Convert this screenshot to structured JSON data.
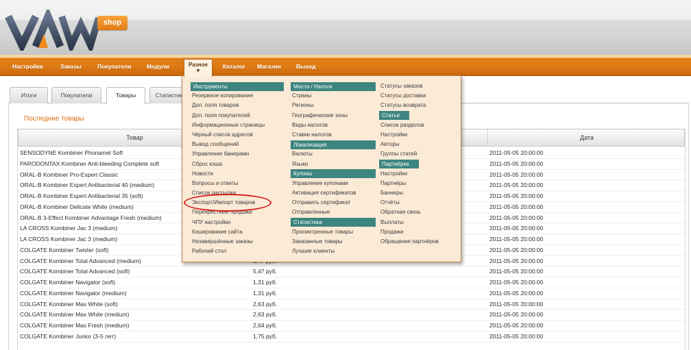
{
  "header": {
    "logo_text": "VAM",
    "logo_badge": "shop"
  },
  "nav": {
    "items": [
      {
        "label": "Настройки"
      },
      {
        "label": "Заказы"
      },
      {
        "label": "Покупатели"
      },
      {
        "label": "Модули"
      },
      {
        "label": "Разное",
        "active": true
      },
      {
        "label": "Каталог"
      },
      {
        "label": "Магазин"
      },
      {
        "label": "Выход"
      }
    ],
    "active_arrow": "▼"
  },
  "tabs": [
    {
      "label": "Итоги"
    },
    {
      "label": "Покупатели"
    },
    {
      "label": "Товары",
      "active": true
    },
    {
      "label": "Статистика"
    }
  ],
  "section_title": "Последние товары",
  "table": {
    "columns": [
      "Товар",
      "",
      "Дата"
    ],
    "rows": [
      {
        "name": "SENSODYNE Kombiner Phonamel Soft",
        "price": "",
        "date": "2011-05-05 20:00:00"
      },
      {
        "name": "PARODONTAX Kombiner Anti-bleeding Complete soft",
        "price": "",
        "date": "2011-05-05 20:00:00"
      },
      {
        "name": "ORAL-B Kombiner Pro-Expert Classic",
        "price": "",
        "date": "2011-05-05 20:00:00"
      },
      {
        "name": "ORAL-B Kombiner Expert Antibacterial 40 (medium)",
        "price": "",
        "date": "2011-05-05 20:00:00"
      },
      {
        "name": "ORAL-B Kombiner Expert Antibacterial 35 (soft)",
        "price": "",
        "date": "2011-05-05 20:00:00"
      },
      {
        "name": "ORAL-B Kombiner Delicate White (medium)",
        "price": "",
        "date": "2011-05-05 20:00:00"
      },
      {
        "name": "ORAL-B 3-Effect Kombiner Advantage Fresh (medium)",
        "price": "",
        "date": "2011-05-05 20:00:00"
      },
      {
        "name": "LA CROSS Kombiner Jac 3 (medium)",
        "price": "",
        "date": "2011-05-05 20:00:00"
      },
      {
        "name": "LA CROSS Kombiner Jac 3 (medium)",
        "price": "",
        "date": "2011-05-05 20:00:00"
      },
      {
        "name": "COLGATE Kombiner Twister (soft)",
        "price": "",
        "date": "2011-05-05 20:00:00"
      },
      {
        "name": "COLGATE Kombiner Total Advanced (medium)",
        "price": "5,47 руб.",
        "date": "2011-05-05 20:00:00"
      },
      {
        "name": "COLGATE Kombiner Total Advanced (soft)",
        "price": "5,47 руб.",
        "date": "2011-05-05 20:00:00"
      },
      {
        "name": "COLGATE Kombiner Navigator (soft)",
        "price": "1,31 руб.",
        "date": "2011-05-05 20:00:00"
      },
      {
        "name": "COLGATE Kombiner Navigator (medium)",
        "price": "1,31 руб.",
        "date": "2011-05-05 20:00:00"
      },
      {
        "name": "COLGATE Kombiner Max White (soft)",
        "price": "2,63 руб.",
        "date": "2011-05-05 20:00:00"
      },
      {
        "name": "COLGATE Kombiner Max White (medium)",
        "price": "2,63 руб.",
        "date": "2011-05-05 20:00:00"
      },
      {
        "name": "COLGATE Kombiner Max Fresh (medium)",
        "price": "2,64 руб.",
        "date": "2011-05-05 20:00:00"
      },
      {
        "name": "COLGATE Kombiner Junior (3-5 лет)",
        "price": "1,75 руб.",
        "date": "2011-05-05 20:00:00"
      }
    ]
  },
  "dropdown": {
    "columns": [
      [
        {
          "label": "Инструменты",
          "header": true
        },
        {
          "label": "Резервное копирование"
        },
        {
          "label": "Доп. поля товаров"
        },
        {
          "label": "Доп. поля покупателей"
        },
        {
          "label": "Информационные страницы"
        },
        {
          "label": "Чёрный список адресов"
        },
        {
          "label": "Вывод сообщений"
        },
        {
          "label": "Управление банерами"
        },
        {
          "label": "Сброс кэша"
        },
        {
          "label": "Новости"
        },
        {
          "label": "Вопросы и ответы"
        },
        {
          "label": "Список рассылки"
        },
        {
          "label": "Экспорт/Импорт товаров"
        },
        {
          "label": "Перекрёстные продажи"
        },
        {
          "label": "ЧПУ настройки"
        },
        {
          "label": "Кэширование сайта"
        },
        {
          "label": "Незавершённые заказы"
        },
        {
          "label": "Рабочий стол"
        }
      ],
      [
        {
          "label": "Места / Налоги",
          "header": true
        },
        {
          "label": "Страны"
        },
        {
          "label": "Регионы"
        },
        {
          "label": "Географические зоны"
        },
        {
          "label": "Виды налогов"
        },
        {
          "label": "Ставки налогов"
        },
        {
          "label": "Локализация",
          "header": true
        },
        {
          "label": "Валюты"
        },
        {
          "label": "Языки"
        },
        {
          "label": "Купоны",
          "header": true
        },
        {
          "label": "Управление купонами"
        },
        {
          "label": "Активация сертификатов"
        },
        {
          "label": "Отправить сертификат"
        },
        {
          "label": "Отправленные"
        },
        {
          "label": "Статистика",
          "header": true
        },
        {
          "label": "Просмотренные товары"
        },
        {
          "label": "Заказанные товары"
        },
        {
          "label": "Лучшие клиенты"
        }
      ],
      [
        {
          "label": "Статусы заказов"
        },
        {
          "label": "Статусы доставки"
        },
        {
          "label": "Статусы возврата"
        },
        {
          "label": "Статьи",
          "header": true
        },
        {
          "label": "Список разделов"
        },
        {
          "label": "Настройки"
        },
        {
          "label": "Авторы"
        },
        {
          "label": "Группы статей"
        },
        {
          "label": "Партнёрка",
          "header": true
        },
        {
          "label": "Настройки"
        },
        {
          "label": "Партнёры"
        },
        {
          "label": "Баннеры"
        },
        {
          "label": "Отчёты"
        },
        {
          "label": "Обратная связь"
        },
        {
          "label": "Выплаты"
        },
        {
          "label": "Продажи"
        },
        {
          "label": "Обращения партнёров"
        }
      ]
    ]
  },
  "colors": {
    "nav_orange": "#de7c16",
    "title_orange": "#d9700e",
    "menu_highlight": "#3d8580",
    "menu_background": "#fbead6",
    "annotation_red": "#d42020"
  }
}
